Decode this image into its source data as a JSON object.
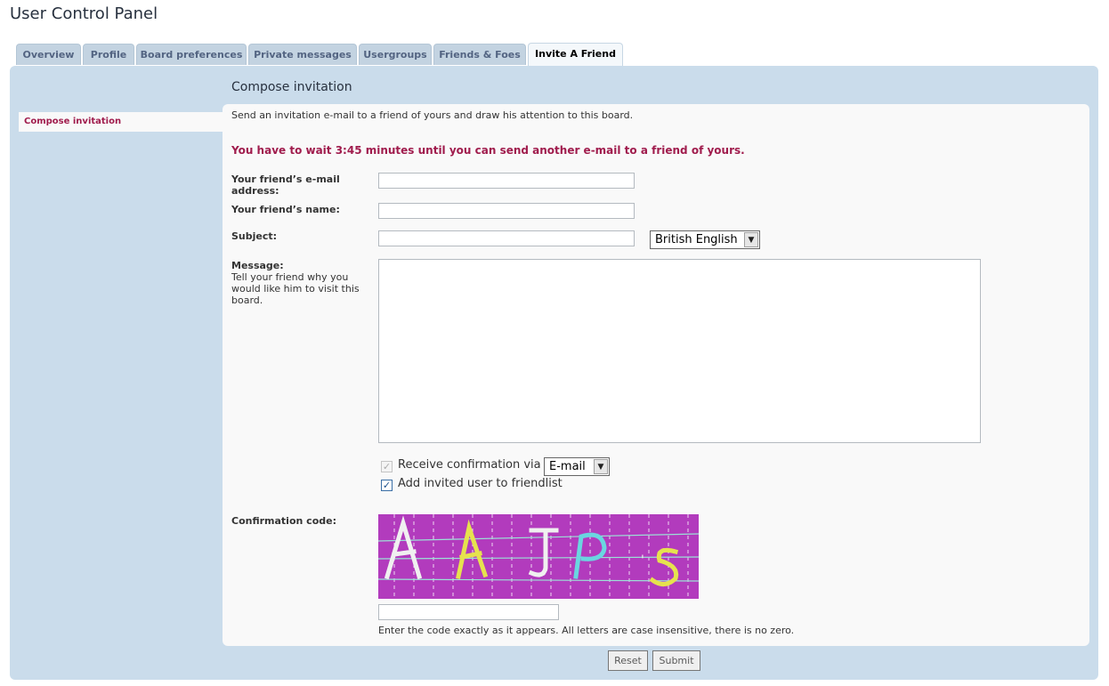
{
  "page_title": "User Control Panel",
  "tabs": [
    {
      "label": "Overview"
    },
    {
      "label": "Profile"
    },
    {
      "label": "Board preferences"
    },
    {
      "label": "Private messages"
    },
    {
      "label": "Usergroups"
    },
    {
      "label": "Friends & Foes"
    },
    {
      "label": "Invite A Friend",
      "active": true
    }
  ],
  "sidebar": {
    "items": [
      {
        "label": "Compose invitation",
        "active": true
      }
    ]
  },
  "section_title": "Compose invitation",
  "intro_text": "Send an invitation e-mail to a friend of yours and draw his attention to this board.",
  "wait_message": "You have to wait 3:45 minutes until you can send another e-mail to a friend of yours.",
  "form": {
    "email_label_line1": "Your friend’s e-mail",
    "email_label_line2": "address:",
    "email_value": "",
    "name_label": "Your friend’s name:",
    "name_value": "",
    "subject_label": "Subject:",
    "subject_value": "",
    "language_selected": "British English",
    "message_label": "Message:",
    "message_help_1": "Tell your friend why you",
    "message_help_2": "would like him to visit this",
    "message_help_3": "board.",
    "message_value": "",
    "receive_confirmation_label": "Receive confirmation via",
    "receive_confirmation_checked": true,
    "receive_confirmation_disabled": true,
    "confirmation_method_selected": "E-mail",
    "add_to_friendlist_label": "Add invited user to friendlist",
    "add_to_friendlist_checked": true,
    "confirmation_code_label": "Confirmation code:",
    "captcha_text": "AAJPS",
    "confirmation_code_value": "",
    "confirmation_hint": "Enter the code exactly as it appears. All letters are case insensitive, there is no zero."
  },
  "buttons": {
    "reset": "Reset",
    "submit": "Submit"
  },
  "colors": {
    "panel_bg": "#cadceb",
    "content_bg": "#f9f9f9",
    "accent_red": "#a01c4d",
    "captcha_bg": "#b23bbd",
    "tab_bg": "#c3d3e1",
    "tab_active_bg": "#f4f8fb"
  }
}
